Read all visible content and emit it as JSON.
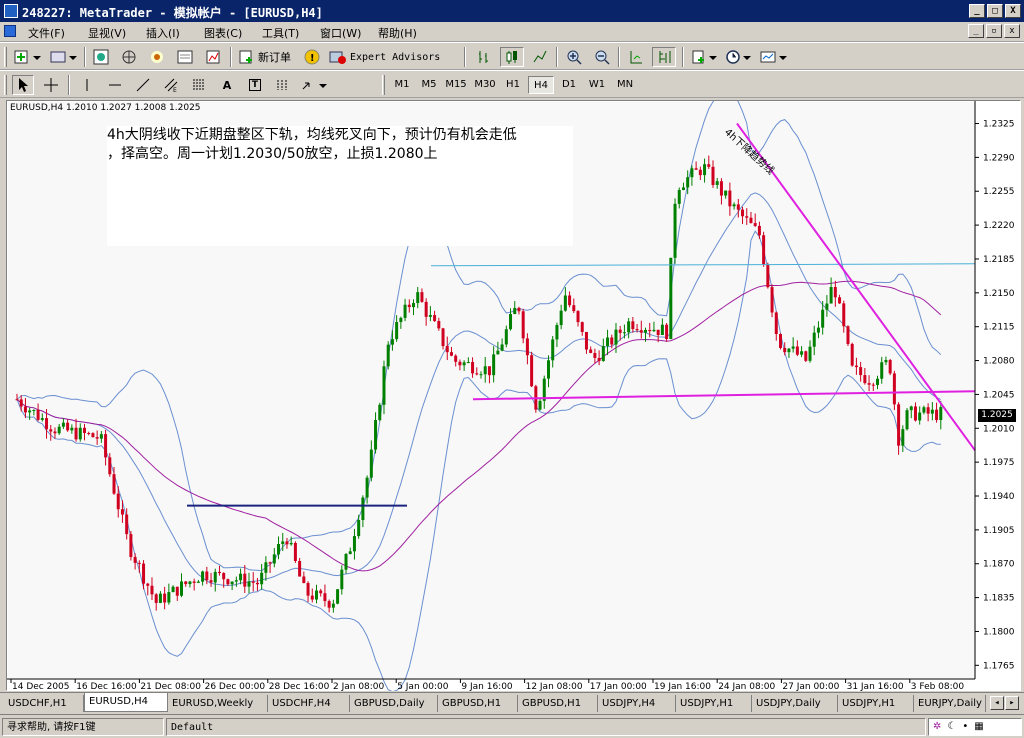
{
  "window": {
    "title": "248227: MetaTrader - 模拟帐户 - [EURUSD,H4]",
    "btn_min": "_",
    "btn_max": "□",
    "btn_close": "X"
  },
  "menu": [
    "文件(F)",
    "显视(V)",
    "插入(I)",
    "图表(C)",
    "工具(T)",
    "窗口(W)",
    "帮助(H)"
  ],
  "toolbar1": {
    "new_order": "新订单",
    "expert_advisors": "Expert Advisors"
  },
  "toolbar2": {
    "text_tool": "A",
    "label_tool": "T",
    "timeframes": [
      "M1",
      "M5",
      "M15",
      "M30",
      "H1",
      "H4",
      "D1",
      "W1",
      "MN"
    ],
    "active_timeframe": "H4"
  },
  "chart": {
    "header": "EURUSD,H4  1.2010 1.2027 1.2008 1.2025",
    "annotation_line1": "4h大阴线收下近期盘整区下轨，均线死叉向下，预计仍有机会走低",
    "annotation_line2": "，择高空。周一计划1.2030/50放空，止损1.2080上",
    "trendline_label": "4h下降趋势线",
    "current_price": "1.2025",
    "colors": {
      "bull": "#008000",
      "bear": "#d00020",
      "bands": "#6a8fd0",
      "ma": "#a020a0",
      "support": "#e020e0",
      "navy_line": "#1a237e",
      "cyan_line": "#48b0d8"
    }
  },
  "chart_data": {
    "type": "candlestick",
    "title": "EURUSD,H4",
    "ohlc_last": {
      "open": 1.201,
      "high": 1.2027,
      "low": 1.2008,
      "close": 1.2025
    },
    "y_ticks": [
      "1.2325",
      "1.2290",
      "1.2255",
      "1.2220",
      "1.2185",
      "1.2150",
      "1.2115",
      "1.2080",
      "1.2045",
      "1.2010",
      "1.1975",
      "1.1940",
      "1.1905",
      "1.1870",
      "1.1835",
      "1.1800",
      "1.1765"
    ],
    "x_ticks": [
      "14 Dec 2005",
      "16 Dec 16:00",
      "21 Dec 08:00",
      "26 Dec 00:00",
      "28 Dec 16:00",
      "2 Jan 08:00",
      "5 Jan 00:00",
      "9 Jan 16:00",
      "12 Jan 08:00",
      "17 Jan 00:00",
      "19 Jan 16:00",
      "24 Jan 08:00",
      "27 Jan 00:00",
      "31 Jan 16:00",
      "3 Feb 08:00"
    ],
    "ylim": [
      1.1755,
      1.234
    ],
    "lines": [
      {
        "name": "resistance_dec",
        "y": 1.193
      },
      {
        "name": "resistance_jan",
        "y": 1.218
      },
      {
        "name": "support_range",
        "y": 1.204
      },
      {
        "name": "downtrend",
        "from": 1.2325,
        "to": 1.201
      }
    ]
  },
  "tabs": [
    "USDCHF,H1",
    "EURUSD,H4",
    "EURUSD,Weekly",
    "USDCHF,H4",
    "GBPUSD,Daily",
    "GBPUSD,H1",
    "GBPUSD,H1",
    "USDJPY,H4",
    "USDJPY,H1",
    "USDJPY,Daily",
    "USDJPY,H1",
    "EURJPY,Daily"
  ],
  "active_tab": "EURUSD,H4",
  "status": {
    "help": "寻求帮助, 请按F1键",
    "profile": "Default"
  }
}
